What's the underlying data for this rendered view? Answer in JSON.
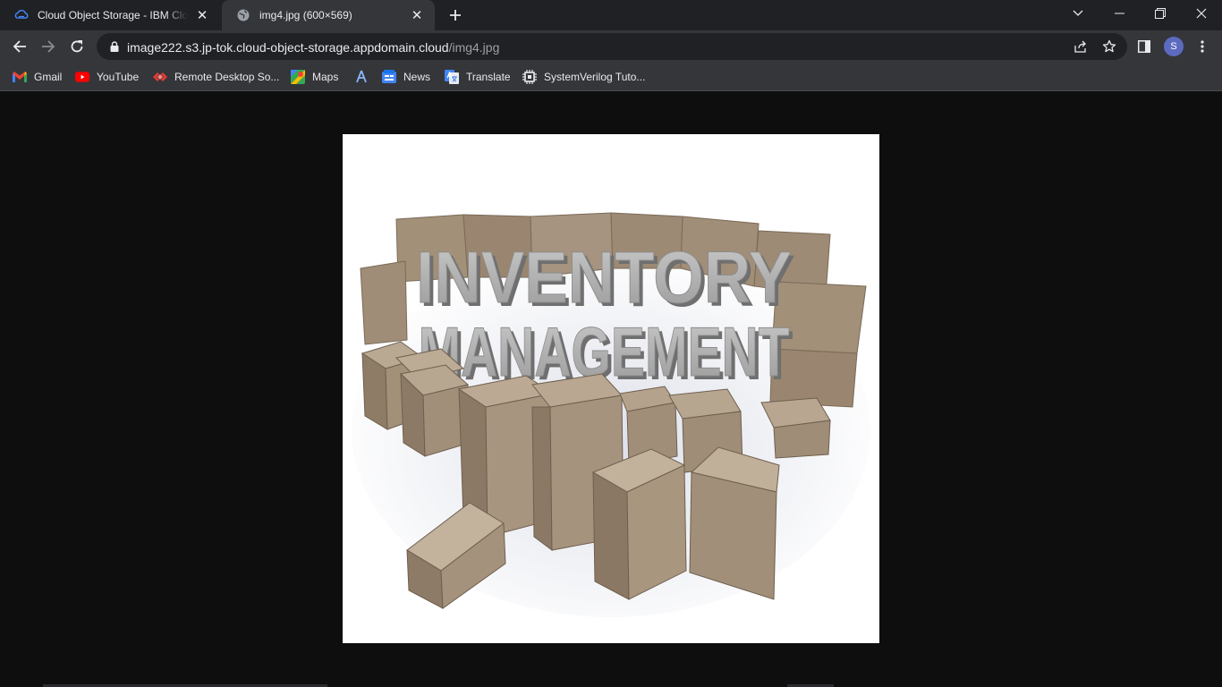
{
  "tabs": [
    {
      "title": "Cloud Object Storage - IBM Cloud",
      "icon": "ibm-cloud-icon",
      "active": false
    },
    {
      "title": "img4.jpg (600×569)",
      "icon": "globe-icon",
      "active": true
    }
  ],
  "address": {
    "host": "image222.s3.jp-tok.cloud-object-storage.appdomain.cloud",
    "path": "/img4.jpg"
  },
  "profile": {
    "initial": "S",
    "color": "#5c6bc0"
  },
  "bookmarks": [
    {
      "label": "Gmail",
      "icon": "gmail-icon"
    },
    {
      "label": "YouTube",
      "icon": "youtube-icon"
    },
    {
      "label": "Remote Desktop So...",
      "icon": "remote-desktop-icon"
    },
    {
      "label": "Maps",
      "icon": "maps-icon"
    },
    {
      "label": "",
      "icon": "app-icon"
    },
    {
      "label": "News",
      "icon": "google-news-icon"
    },
    {
      "label": "Translate",
      "icon": "google-translate-icon"
    },
    {
      "label": "SystemVerilog Tuto...",
      "icon": "chip-icon"
    }
  ],
  "image": {
    "line1": "INVENTORY",
    "line2": "MANAGEMENT",
    "box_color": "#a08e78"
  }
}
